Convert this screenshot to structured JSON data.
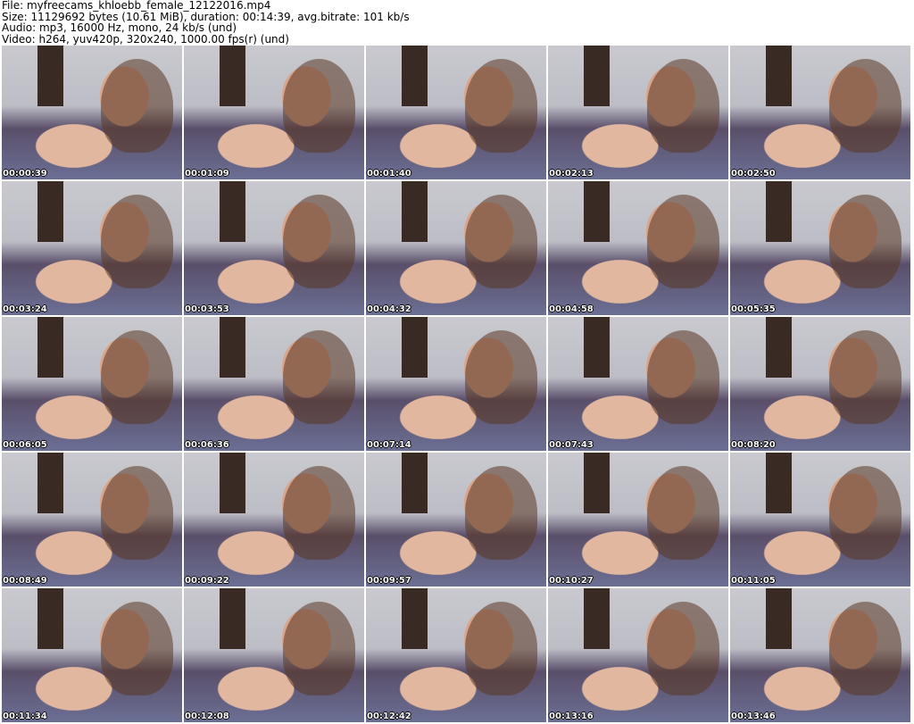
{
  "info": {
    "file": "File: myfreecams_khloebb_female_12122016.mp4",
    "size": "Size: 11129692 bytes (10.61 MiB), duration: 00:14:39, avg.bitrate: 101 kb/s",
    "audio": "Audio: mp3, 16000 Hz, mono, 24 kb/s (und)",
    "video": "Video: h264, yuv420p, 320x240, 1000.00 fps(r) (und)"
  },
  "timestamps": [
    "00:00:39",
    "00:01:09",
    "00:01:40",
    "00:02:13",
    "00:02:50",
    "00:03:24",
    "00:03:53",
    "00:04:32",
    "00:04:58",
    "00:05:35",
    "00:06:05",
    "00:06:36",
    "00:07:14",
    "00:07:43",
    "00:08:20",
    "00:08:49",
    "00:09:22",
    "00:09:57",
    "00:10:27",
    "00:11:05",
    "00:11:34",
    "00:12:08",
    "00:12:42",
    "00:13:16",
    "00:13:46"
  ]
}
